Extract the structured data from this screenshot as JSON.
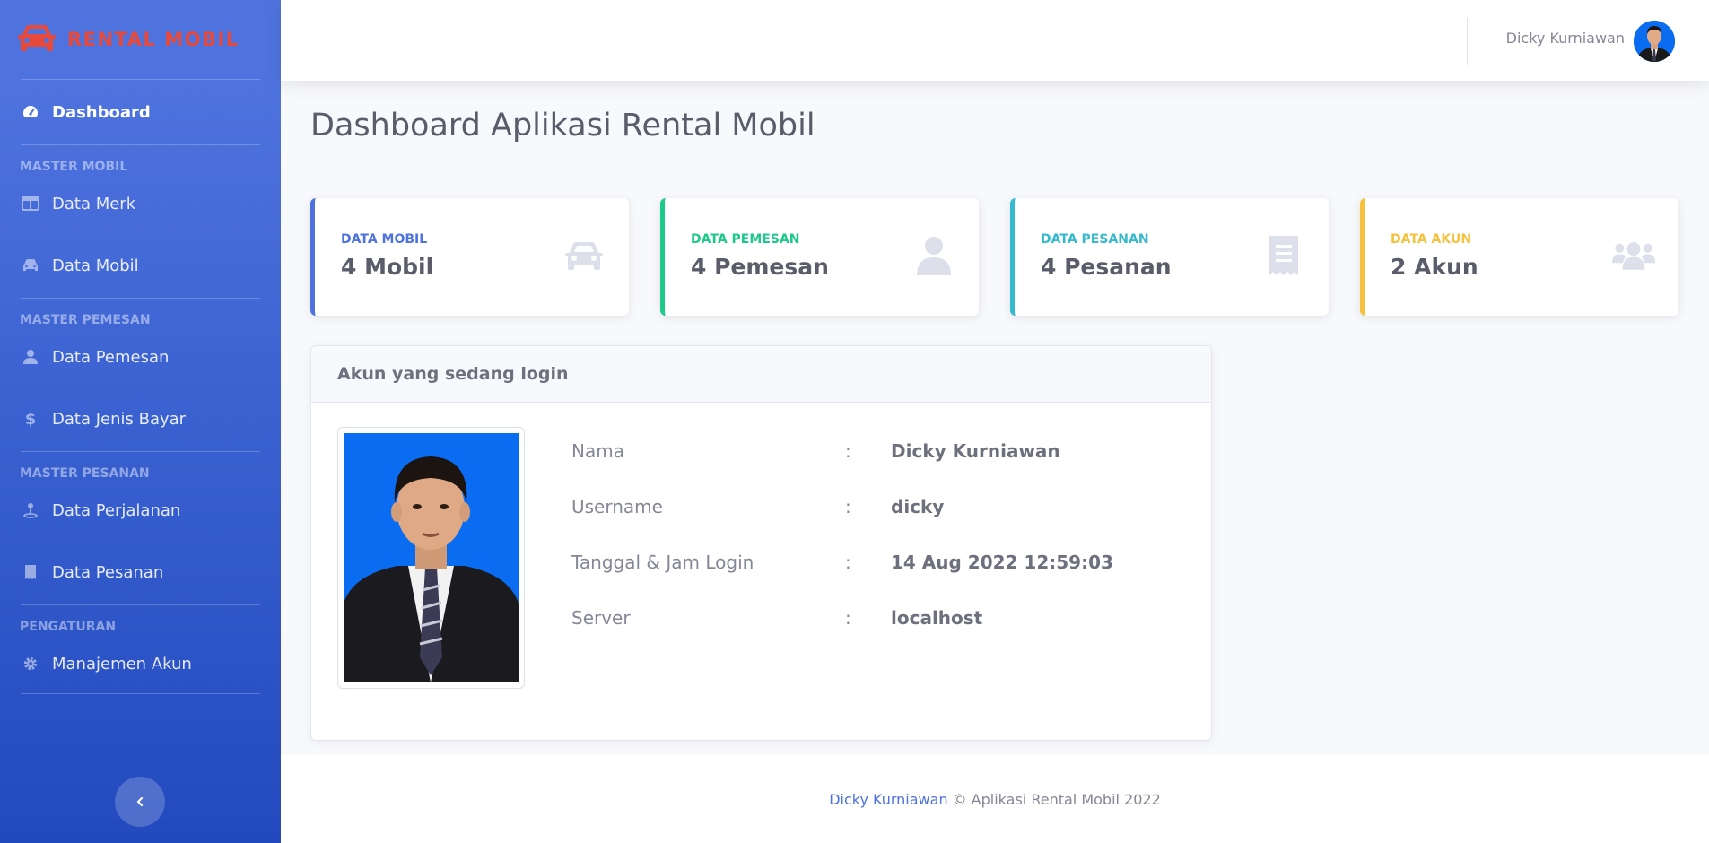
{
  "brand": {
    "name": "RENTAL MOBIL"
  },
  "sidebar": {
    "dashboard": "Dashboard",
    "sections": [
      {
        "heading": "MASTER MOBIL",
        "items": [
          "Data Merk",
          "Data Mobil"
        ]
      },
      {
        "heading": "MASTER PEMESAN",
        "items": [
          "Data Pemesan",
          "Data Jenis Bayar"
        ]
      },
      {
        "heading": "MASTER PESANAN",
        "items": [
          "Data Perjalanan",
          "Data Pesanan"
        ]
      },
      {
        "heading": "PENGATURAN",
        "items": [
          "Manajemen Akun"
        ]
      }
    ],
    "toggle_icon": "chevron-left-icon"
  },
  "topbar": {
    "user_name": "Dicky Kurniawan"
  },
  "page": {
    "title": "Dashboard Aplikasi Rental Mobil"
  },
  "cards": [
    {
      "label": "DATA MOBIL",
      "value": "4 Mobil",
      "color": "#4e73df",
      "icon": "car-icon"
    },
    {
      "label": "DATA PEMESAN",
      "value": "4 Pemesan",
      "color": "#1cc88a",
      "icon": "user-icon"
    },
    {
      "label": "DATA PESANAN",
      "value": "4 Pesanan",
      "color": "#36b9cc",
      "icon": "receipt-icon"
    },
    {
      "label": "DATA AKUN",
      "value": "2 Akun",
      "color": "#f6c23e",
      "icon": "users-icon"
    }
  ],
  "login_panel": {
    "title": "Akun yang sedang login",
    "rows": [
      {
        "label": "Nama",
        "sep": ":",
        "value": "Dicky Kurniawan"
      },
      {
        "label": "Username",
        "sep": ":",
        "value": "dicky"
      },
      {
        "label": "Tanggal & Jam Login",
        "sep": ":",
        "value": "14 Aug 2022 12:59:03"
      },
      {
        "label": "Server",
        "sep": ":",
        "value": "localhost"
      }
    ]
  },
  "footer": {
    "author": "Dicky Kurniawan",
    "text": "© Aplikasi Rental Mobil 2022"
  }
}
